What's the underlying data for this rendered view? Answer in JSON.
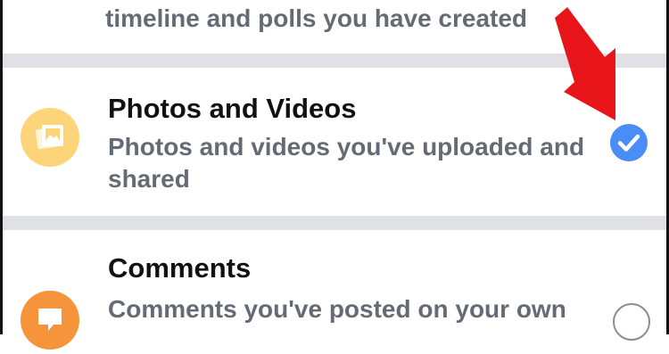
{
  "sections": {
    "top_partial": {
      "description": "timeline and polls you have created"
    },
    "photos": {
      "title": "Photos and Videos",
      "description_line1": "Photos and videos you've uploaded and",
      "description_line2": "shared",
      "icon": "photo-icon",
      "icon_color": "#fcd57a",
      "selected": true,
      "check_color": "#4a8df6"
    },
    "comments": {
      "title": "Comments",
      "description_line1": "Comments you've posted on your own",
      "icon": "comment-icon",
      "icon_color": "#f5943b",
      "selected": false
    }
  },
  "annotation": {
    "arrow_color": "#e8151a",
    "icon": "red-arrow-annotation"
  }
}
